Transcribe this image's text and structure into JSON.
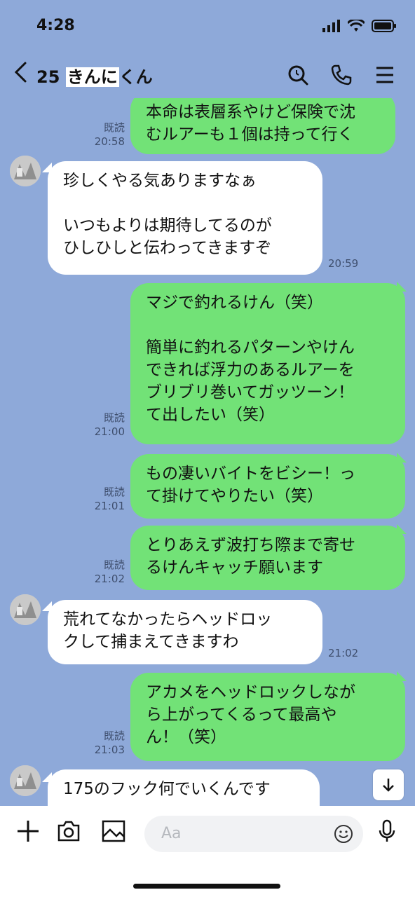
{
  "status": {
    "time": "4:28"
  },
  "header": {
    "back_icon": "chevron-left-icon",
    "room_prefix": "25 ",
    "room_name": "きんに",
    "room_suffix": "くん"
  },
  "messages": [
    {
      "from": "me",
      "text": "本命は表層系やけど保険で沈\nむルアーも１個は持って行く",
      "read": "既読",
      "time": "20:58"
    },
    {
      "from": "them",
      "text": "珍しくやる気ありますなぁ\n\nいつもよりは期待してるのが\nひしひしと伝わってきますぞ",
      "time": "20:59"
    },
    {
      "from": "me",
      "text": "マジで釣れるけん（笑）\n\n簡単に釣れるパターンやけん\nできれば浮力のあるルアーを\nブリブリ巻いてガッツーン！\nて出したい（笑）",
      "read": "既読",
      "time": "21:00"
    },
    {
      "from": "me",
      "text": "もの凄いバイトをビシー！っ\nて掛けてやりたい（笑）",
      "read": "既読",
      "time": "21:01"
    },
    {
      "from": "me",
      "text": "とりあえず波打ち際まで寄せ\nるけんキャッチ願います",
      "read": "既読",
      "time": "21:02"
    },
    {
      "from": "them",
      "text": "荒れてなかったらヘッドロッ\nクして捕まえてきますわ",
      "time": "21:02"
    },
    {
      "from": "me",
      "text": "アカメをヘッドロックしなが\nら上がってくるって最高や\nん！（笑）",
      "read": "既読",
      "time": "21:03"
    },
    {
      "from": "them",
      "text": "175のフック何でいくんです"
    }
  ],
  "input": {
    "placeholder": "Aa"
  },
  "colors": {
    "background": "#8ea9d9",
    "mine_bubble": "#72e277",
    "their_bubble": "#ffffff"
  }
}
